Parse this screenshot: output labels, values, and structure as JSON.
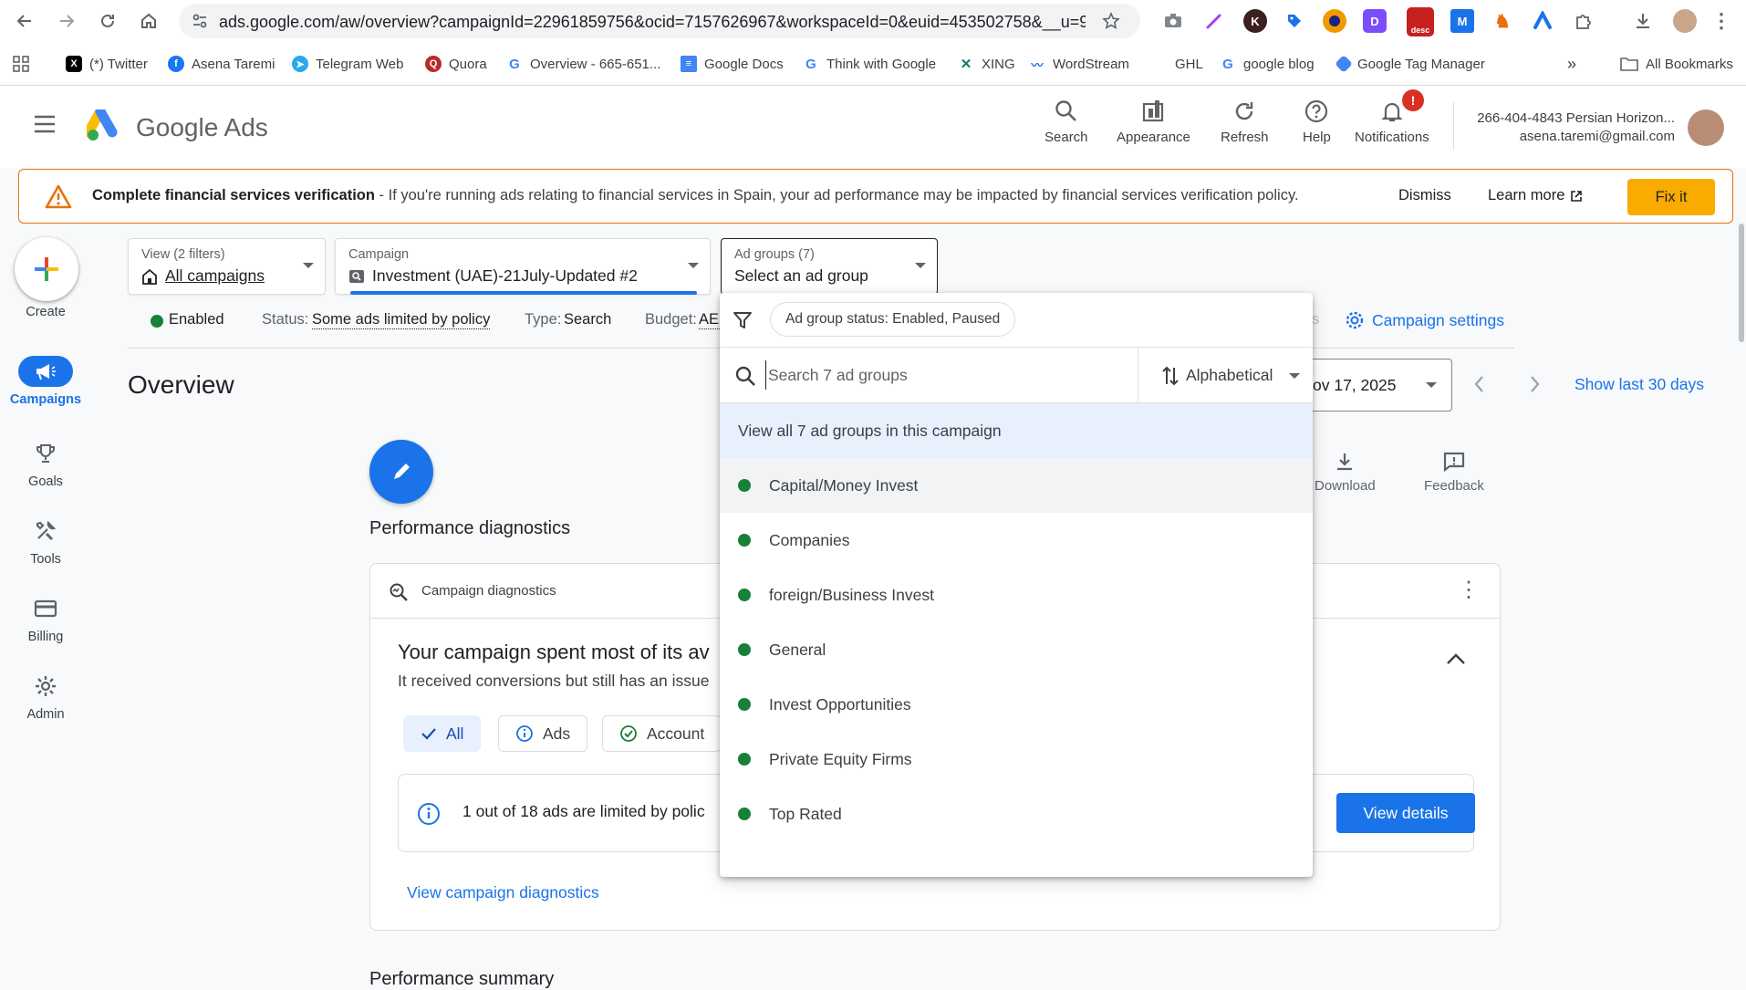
{
  "browser": {
    "url": "ads.google.com/aw/overview?campaignId=22961859756&ocid=7157626967&workspaceId=0&euid=453502758&__u=93...",
    "extensions": [
      "camera-icon",
      "pen-icon",
      "k-ext",
      "tag-ext",
      "moon-ext",
      "d-ext",
      "desc-ext",
      "m-ext",
      "bird-ext",
      "arc-ext",
      "puzzle-icon"
    ],
    "desc_badge": "desc",
    "bookmarks": [
      {
        "label": "(*) Twitter",
        "icon": "x-icon"
      },
      {
        "label": "Asena Taremi",
        "icon": "facebook-icon"
      },
      {
        "label": "Telegram Web",
        "icon": "telegram-icon"
      },
      {
        "label": "Quora",
        "icon": "quora-icon"
      },
      {
        "label": "Overview - 665-651...",
        "icon": "google-icon"
      },
      {
        "label": "Google Docs",
        "icon": "docs-icon"
      },
      {
        "label": "Think with Google",
        "icon": "google-icon"
      },
      {
        "label": "XING",
        "icon": "xing-icon"
      },
      {
        "label": "WordStream",
        "icon": "wordstream-icon"
      },
      {
        "label": "GHL",
        "icon": ""
      },
      {
        "label": "google blog",
        "icon": "google-icon"
      },
      {
        "label": "Google Tag Manager",
        "icon": "gtm-icon"
      }
    ],
    "all_bookmarks": "All Bookmarks"
  },
  "header": {
    "brand_google": "Google",
    "brand_ads": "Ads",
    "actions": [
      {
        "label": "Search",
        "icon": "search-icon"
      },
      {
        "label": "Appearance",
        "icon": "appearance-icon"
      },
      {
        "label": "Refresh",
        "icon": "refresh-icon"
      },
      {
        "label": "Help",
        "icon": "help-icon"
      },
      {
        "label": "Notifications",
        "icon": "bell-icon"
      }
    ],
    "notification_badge": "!",
    "account_name": "266-404-4843 Persian Horizon...",
    "account_email": "asena.taremi@gmail.com"
  },
  "banner": {
    "title": "Complete financial services verification",
    "message": " - If you're running ads relating to financial services in Spain, your ad performance may be impacted by financial services verification policy.",
    "dismiss": "Dismiss",
    "learn_more": "Learn more",
    "fix_it": "Fix it"
  },
  "nav": {
    "create": "Create",
    "items": [
      {
        "label": "Campaigns",
        "icon": "campaigns-icon",
        "active": true
      },
      {
        "label": "Goals",
        "icon": "trophy-icon"
      },
      {
        "label": "Tools",
        "icon": "tools-icon"
      },
      {
        "label": "Billing",
        "icon": "billing-icon"
      },
      {
        "label": "Admin",
        "icon": "gear-icon"
      }
    ]
  },
  "selectors": {
    "view_label": "View (2 filters)",
    "view_value": "All campaigns",
    "campaign_label": "Campaign",
    "campaign_value": "Investment (UAE)-21July-Updated #2",
    "adgroup_label": "Ad groups (7)",
    "adgroup_value": "Select an ad group"
  },
  "status_row": {
    "enabled": "Enabled",
    "status_label": "Status:",
    "status_value": "Some ads limited by policy",
    "type_label": "Type:",
    "type_value": "Search",
    "budget_label": "Budget:",
    "budget_value": "AEI",
    "trailing": "s",
    "campaign_settings": "Campaign settings"
  },
  "overview": {
    "title": "Overview",
    "date": "ov 17, 2025",
    "show_last": "Show last 30 days",
    "download": "Download",
    "feedback": "Feedback"
  },
  "diagnostics": {
    "section_title": "Performance diagnostics",
    "card_title": "Campaign diagnostics",
    "headline": "Your campaign spent most of its av",
    "subline": "It received conversions but still has an issue",
    "chips": [
      "All",
      "Ads",
      "Account"
    ],
    "limited_text": "1 out of 18 ads are limited by polic",
    "view_details": "View details",
    "view_link": "View campaign diagnostics",
    "summary_title": "Performance summary"
  },
  "dropdown": {
    "filter_chip": "Ad group status: Enabled, Paused",
    "search_placeholder": "Search 7 ad groups",
    "sort": "Alphabetical",
    "view_all": "View all 7 ad groups in this campaign",
    "items": [
      "Capital/Money Invest",
      "Companies",
      "foreign/Business Invest",
      "General",
      "Invest Opportunities",
      "Private Equity Firms",
      "Top Rated"
    ]
  }
}
